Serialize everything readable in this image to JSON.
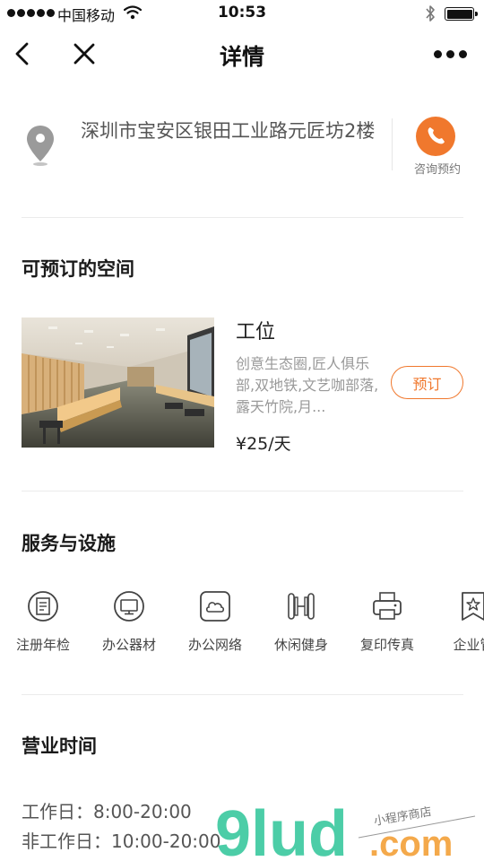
{
  "status_bar": {
    "carrier": "中国移动",
    "time": "10:53",
    "signal_icon": "signal-dots-icon",
    "wifi_icon": "wifi-icon",
    "bluetooth_icon": "bluetooth-icon",
    "battery_icon": "battery-icon"
  },
  "nav": {
    "title": "详情",
    "back_icon": "chevron-left-icon",
    "close_icon": "close-icon",
    "more_icon": "more-dots-icon"
  },
  "address": {
    "text": "深圳市宝安区银田工业路元匠坊2楼",
    "phone_label": "咨询预约",
    "pin_icon": "location-pin-icon",
    "phone_icon": "phone-icon"
  },
  "spaces": {
    "title": "可预订的空间",
    "items": [
      {
        "name": "工位",
        "description": "创意生态圈,匠人俱乐部,双地铁,文艺咖部落,露天竹院,月...",
        "price": "¥25/天",
        "book_label": "预订"
      }
    ]
  },
  "services": {
    "title": "服务与设施",
    "items": [
      {
        "label": "注册年检",
        "icon": "registration-icon"
      },
      {
        "label": "办公器材",
        "icon": "monitor-icon"
      },
      {
        "label": "办公网络",
        "icon": "cloud-network-icon"
      },
      {
        "label": "休闲健身",
        "icon": "dumbbell-icon"
      },
      {
        "label": "复印传真",
        "icon": "printer-icon"
      },
      {
        "label": "企业管",
        "icon": "star-badge-icon"
      }
    ]
  },
  "hours": {
    "title": "营业时间",
    "workday": "工作日：8:00-20:00",
    "non_workday": "非工作日：10:00-20:00"
  },
  "watermark": {
    "brand": "9lud",
    "domain": ".com",
    "tagline": "小程序商店"
  },
  "colors": {
    "accent": "#f0782d",
    "watermark_green": "#3dc9a0",
    "watermark_orange": "#f4a23c"
  }
}
